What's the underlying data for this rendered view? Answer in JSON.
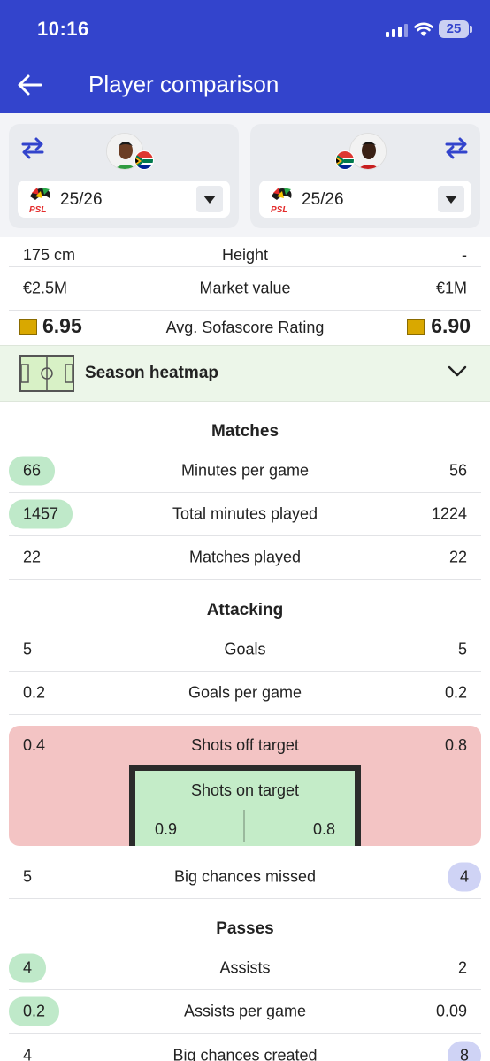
{
  "status": {
    "time": "10:16",
    "battery": "25"
  },
  "header": {
    "title": "Player comparison"
  },
  "players": [
    {
      "season": "25/26"
    },
    {
      "season": "25/26"
    }
  ],
  "bio": [
    {
      "left": "175 cm",
      "label": "Height",
      "right": "-"
    },
    {
      "left": "€2.5M",
      "label": "Market value",
      "right": "€1M"
    }
  ],
  "rating": {
    "left": "6.95",
    "label": "Avg. Sofascore Rating",
    "right": "6.90",
    "color": "#d9a800"
  },
  "heatmap": {
    "label": "Season heatmap"
  },
  "sections": {
    "matches": "Matches",
    "attacking": "Attacking",
    "passes": "Passes"
  },
  "matches": [
    {
      "left": "66",
      "label": "Minutes per game",
      "right": "56"
    },
    {
      "left": "1457",
      "label": "Total minutes played",
      "right": "1224"
    },
    {
      "left": "22",
      "label": "Matches played",
      "right": "22"
    }
  ],
  "attacking": [
    {
      "left": "5",
      "label": "Goals",
      "right": "5"
    },
    {
      "left": "0.2",
      "label": "Goals per game",
      "right": "0.2"
    }
  ],
  "shots": {
    "off_left": "0.4",
    "off_label": "Shots off target",
    "off_right": "0.8",
    "on_label": "Shots on target",
    "on_left": "0.9",
    "on_right": "0.8"
  },
  "big_chances_missed": {
    "left": "5",
    "label": "Big chances missed",
    "right": "4"
  },
  "passes": [
    {
      "left": "4",
      "label": "Assists",
      "right": "2"
    },
    {
      "left": "0.2",
      "label": "Assists per game",
      "right": "0.09"
    },
    {
      "left": "4",
      "label": "Big chances created",
      "right": "8"
    }
  ],
  "colors": {
    "header": "#3344cc",
    "pill_green": "#bfe9c9",
    "pill_blue": "#cfd3f5",
    "shots_bg": "#f3c4c4",
    "goal_bg": "#c4ecc8"
  }
}
